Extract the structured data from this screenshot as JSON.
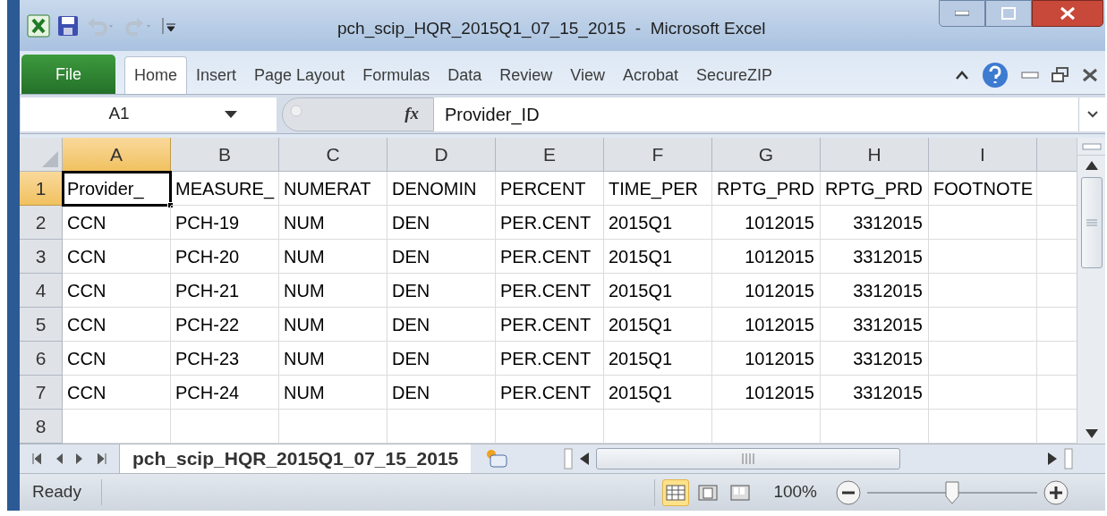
{
  "window": {
    "title": "pch_scip_HQR_2015Q1_07_15_2015  -  Microsoft Excel"
  },
  "ribbon_tabs": [
    {
      "label": "File",
      "kind": "file",
      "selected": false
    },
    {
      "label": "Home",
      "kind": "tab",
      "selected": true
    },
    {
      "label": "Insert",
      "kind": "tab",
      "selected": false
    },
    {
      "label": "Page Layout",
      "kind": "tab",
      "selected": false
    },
    {
      "label": "Formulas",
      "kind": "tab",
      "selected": false
    },
    {
      "label": "Data",
      "kind": "tab",
      "selected": false
    },
    {
      "label": "Review",
      "kind": "tab",
      "selected": false
    },
    {
      "label": "View",
      "kind": "tab",
      "selected": false
    },
    {
      "label": "Acrobat",
      "kind": "tab",
      "selected": false
    },
    {
      "label": "SecureZIP",
      "kind": "tab",
      "selected": false
    }
  ],
  "formula_bar": {
    "name_box": "A1",
    "fx": "fx",
    "formula": "Provider_ID"
  },
  "columns": [
    {
      "label": "A",
      "kind": "text",
      "selected": true
    },
    {
      "label": "B",
      "kind": "text",
      "selected": false
    },
    {
      "label": "C",
      "kind": "text",
      "selected": false
    },
    {
      "label": "D",
      "kind": "text",
      "selected": false
    },
    {
      "label": "E",
      "kind": "text",
      "selected": false
    },
    {
      "label": "F",
      "kind": "text",
      "selected": false
    },
    {
      "label": "G",
      "kind": "number",
      "selected": false
    },
    {
      "label": "H",
      "kind": "number",
      "selected": false
    },
    {
      "label": "I",
      "kind": "text",
      "selected": false
    }
  ],
  "rows": [
    {
      "header": "1",
      "selected": true,
      "cells": [
        "Provider_",
        "MEASURE_",
        "NUMERAT",
        "DENOMIN",
        "PERCENT",
        "TIME_PER",
        "RPTG_PRD",
        "RPTG_PRD",
        "FOOTNOTE"
      ]
    },
    {
      "header": "2",
      "selected": false,
      "cells": [
        "CCN",
        "PCH-19",
        "NUM",
        "DEN",
        "PER.CENT",
        "2015Q1",
        "1012015",
        "3312015"
      ]
    },
    {
      "header": "3",
      "selected": false,
      "cells": [
        "CCN",
        "PCH-20",
        "NUM",
        "DEN",
        "PER.CENT",
        "2015Q1",
        "1012015",
        "3312015"
      ]
    },
    {
      "header": "4",
      "selected": false,
      "cells": [
        "CCN",
        "PCH-21",
        "NUM",
        "DEN",
        "PER.CENT",
        "2015Q1",
        "1012015",
        "3312015"
      ]
    },
    {
      "header": "5",
      "selected": false,
      "cells": [
        "CCN",
        "PCH-22",
        "NUM",
        "DEN",
        "PER.CENT",
        "2015Q1",
        "1012015",
        "3312015"
      ]
    },
    {
      "header": "6",
      "selected": false,
      "cells": [
        "CCN",
        "PCH-23",
        "NUM",
        "DEN",
        "PER.CENT",
        "2015Q1",
        "1012015",
        "3312015"
      ]
    },
    {
      "header": "7",
      "selected": false,
      "cells": [
        "CCN",
        "PCH-24",
        "NUM",
        "DEN",
        "PER.CENT",
        "2015Q1",
        "1012015",
        "3312015"
      ]
    },
    {
      "header": "8",
      "selected": false,
      "cells": []
    }
  ],
  "sheet_tabs": [
    {
      "label": "pch_scip_HQR_2015Q1_07_15_2015",
      "selected": true
    }
  ],
  "status_bar": {
    "status": "Ready",
    "views": [
      {
        "kind": "normal",
        "selected": true
      },
      {
        "kind": "page-layout",
        "selected": false
      },
      {
        "kind": "page-break",
        "selected": false
      }
    ],
    "zoom": "100%",
    "zoom_slider": {
      "level": 0.5
    }
  }
}
